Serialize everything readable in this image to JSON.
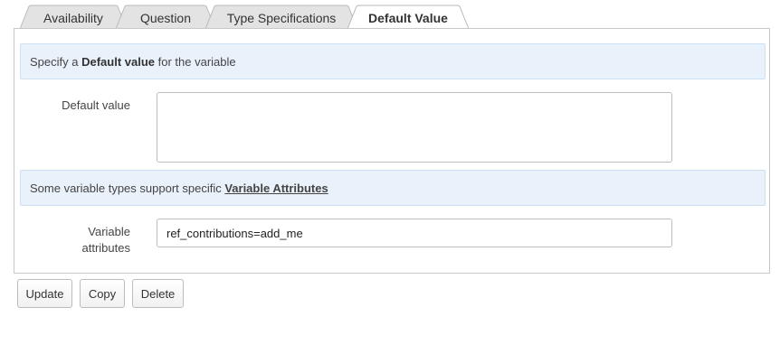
{
  "tabs": [
    {
      "label": "Availability",
      "active": false
    },
    {
      "label": "Question",
      "active": false
    },
    {
      "label": "Type Specifications",
      "active": false
    },
    {
      "label": "Default Value",
      "active": true
    }
  ],
  "default_info": {
    "prefix": "Specify a ",
    "bold": "Default value",
    "suffix": " for the variable"
  },
  "default_value": {
    "label": "Default value",
    "value": ""
  },
  "attributes_info": {
    "prefix": "Some variable types support specific ",
    "link": "Variable Attributes"
  },
  "variable_attributes": {
    "label_line1": "Variable",
    "label_line2": "attributes",
    "value": "ref_contributions=add_me"
  },
  "buttons": {
    "update": "Update",
    "copy": "Copy",
    "delete": "Delete"
  },
  "colors": {
    "info_background": "#e9f1fb",
    "tab_inactive": "#e2e2e2",
    "border": "#c8c8c8"
  }
}
